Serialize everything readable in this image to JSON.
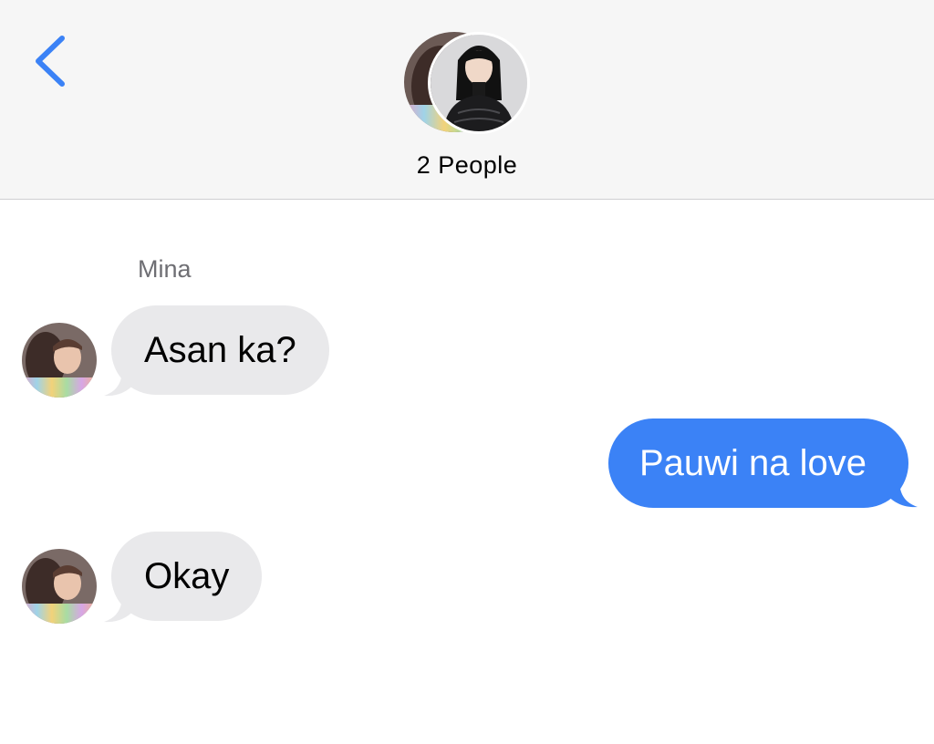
{
  "header": {
    "back_icon": "chevron-left-icon",
    "title": "2 People",
    "accent_color": "#3b82f6",
    "group_avatars": [
      "participant-avatar",
      "participant-avatar"
    ]
  },
  "conversation": {
    "sender_name": "Mina",
    "messages": [
      {
        "direction": "incoming",
        "text": "Asan ka?"
      },
      {
        "direction": "outgoing",
        "text": "Pauwi na love"
      },
      {
        "direction": "incoming",
        "text": "Okay"
      }
    ]
  },
  "colors": {
    "incoming_bubble": "#e9e9eb",
    "outgoing_bubble": "#3b82f6",
    "header_bg": "#f6f6f6"
  }
}
